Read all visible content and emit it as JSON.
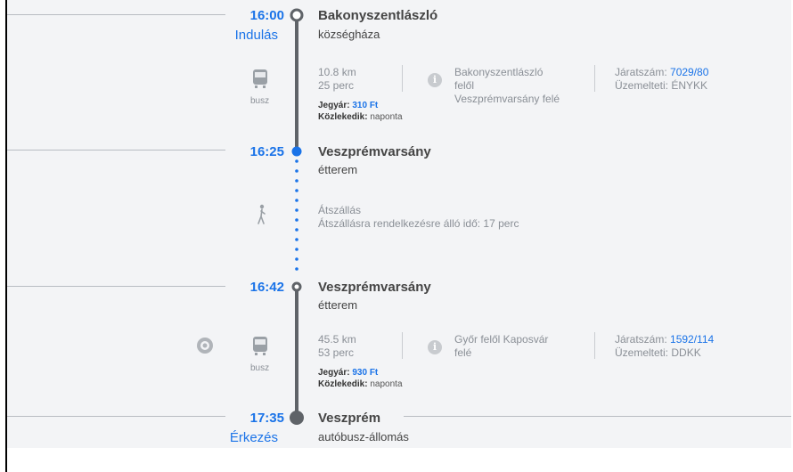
{
  "segments": [
    {
      "time": "16:00",
      "label": "Indulás",
      "stop": "Bakonyszentlászló",
      "stop_sub": "községháza"
    },
    {
      "mode_label": "busz",
      "distance": "10.8 km",
      "duration": "25 perc",
      "fare_label": "Jegyár:",
      "fare": "310 Ft",
      "runs_label": "Közlekedik:",
      "runs": "naponta",
      "dir_1": "Bakonyszentlászló",
      "dir_2": "felől",
      "dir_3": "Veszprémvarsány felé",
      "route_label": "Járatszám:",
      "route_no": "7029/80",
      "operator_label": "Üzemelteti:",
      "operator": "ÉNYKK"
    },
    {
      "time": "16:25",
      "stop": "Veszprémvarsány",
      "stop_sub": "étterem"
    },
    {
      "transfer_title": "Átszállás",
      "transfer_text": "Átszállásra rendelkezésre álló idő: 17 perc"
    },
    {
      "time": "16:42",
      "stop": "Veszprémvarsány",
      "stop_sub": "étterem"
    },
    {
      "mode_label": "busz",
      "distance": "45.5 km",
      "duration": "53 perc",
      "fare_label": "Jegyár:",
      "fare": "930 Ft",
      "runs_label": "Közlekedik:",
      "runs": "naponta",
      "dir_1": "Győr felől Kaposvár",
      "dir_2": "felé",
      "route_label": "Járatszám:",
      "route_no": "1592/114",
      "operator_label": "Üzemelteti:",
      "operator": "DDKK"
    },
    {
      "time": "17:35",
      "label": "Érkezés",
      "stop": "Veszprém",
      "stop_sub": "autóbusz-állomás"
    }
  ],
  "colors": {
    "accent": "#1a73e8",
    "line": "#5f6368",
    "background": "#f3f4f6"
  },
  "icons": {
    "bus": "bus-icon",
    "walk": "walking-person-icon",
    "info": "info-icon",
    "target": "target-icon"
  }
}
